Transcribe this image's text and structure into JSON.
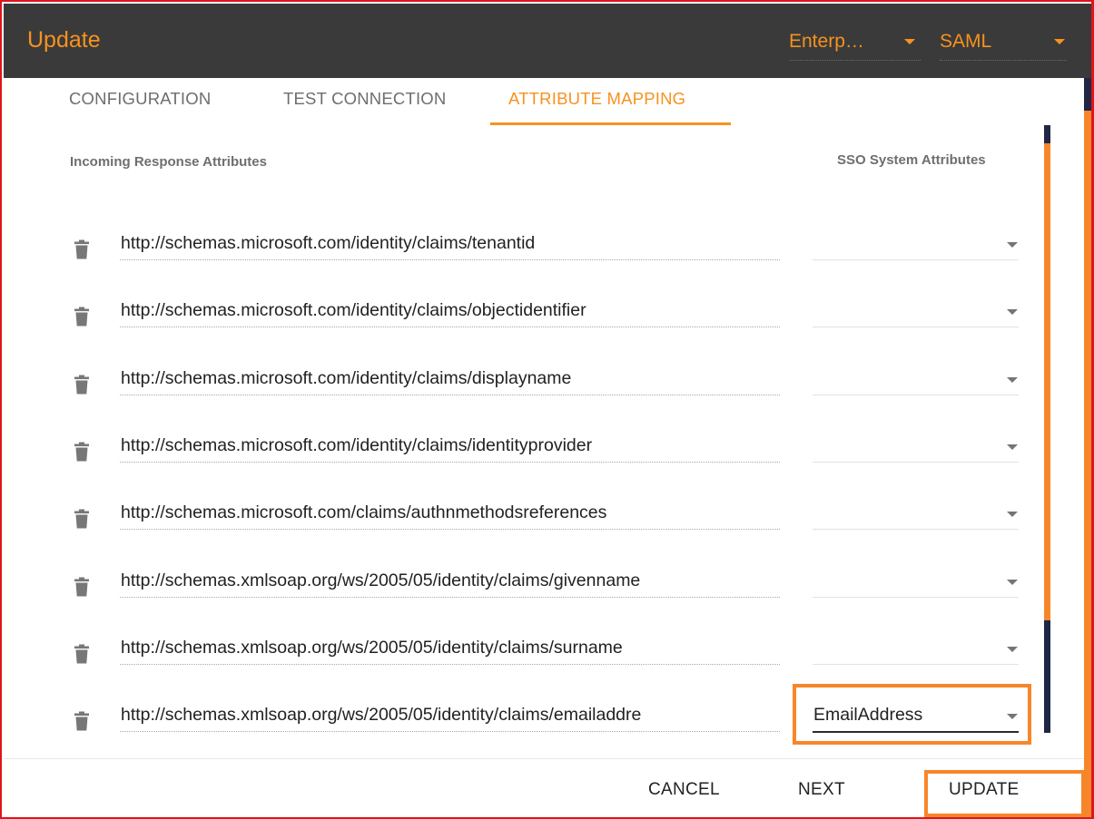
{
  "header": {
    "title": "Update",
    "directory_select": "Enterp…",
    "protocol_select": "SAML"
  },
  "tabs": [
    {
      "label": "CONFIGURATION",
      "active": false
    },
    {
      "label": "TEST CONNECTION",
      "active": false
    },
    {
      "label": "ATTRIBUTE MAPPING",
      "active": true
    }
  ],
  "columns": {
    "incoming": "Incoming Response Attributes",
    "system": "SSO System Attributes"
  },
  "mappings": [
    {
      "attribute": "http://schemas.microsoft.com/identity/claims/tenantid",
      "system_value": ""
    },
    {
      "attribute": "http://schemas.microsoft.com/identity/claims/objectidentifier",
      "system_value": ""
    },
    {
      "attribute": "http://schemas.microsoft.com/identity/claims/displayname",
      "system_value": ""
    },
    {
      "attribute": "http://schemas.microsoft.com/identity/claims/identityprovider",
      "system_value": ""
    },
    {
      "attribute": "http://schemas.microsoft.com/claims/authnmethodsreferences",
      "system_value": ""
    },
    {
      "attribute": "http://schemas.xmlsoap.org/ws/2005/05/identity/claims/givenname",
      "system_value": ""
    },
    {
      "attribute": "http://schemas.xmlsoap.org/ws/2005/05/identity/claims/surname",
      "system_value": ""
    },
    {
      "attribute": "http://schemas.xmlsoap.org/ws/2005/05/identity/claims/emailaddre",
      "system_value": "EmailAddress"
    }
  ],
  "footer": {
    "cancel": "CANCEL",
    "next": "NEXT",
    "update": "UPDATE"
  },
  "colors": {
    "accent": "#f7921e",
    "highlight": "#f7862a",
    "header_bg": "#3a3a3a",
    "frame": "#e0141e"
  },
  "icons": {
    "row_delete": "trash-icon",
    "dropdown": "caret-down-icon"
  }
}
